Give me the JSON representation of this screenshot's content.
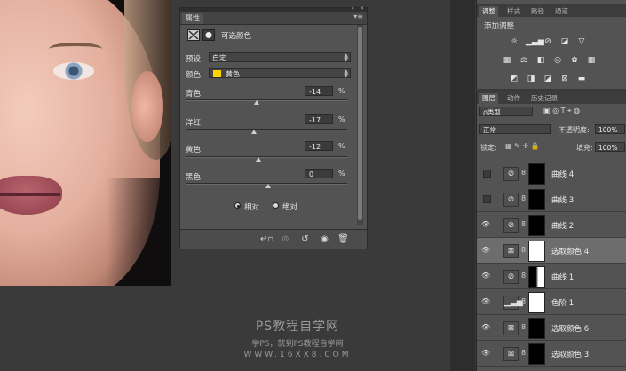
{
  "properties_panel": {
    "tab_title": "属性",
    "header_label": "可选颜色",
    "preset": {
      "label": "预设:",
      "value": "自定"
    },
    "colors": {
      "label": "颜色:",
      "value": "黄色",
      "swatch": "#ffd400"
    },
    "sliders": [
      {
        "label": "青色:",
        "value": "-14",
        "unit": "%",
        "position": 0.43
      },
      {
        "label": "洋红:",
        "value": "-17",
        "unit": "%",
        "position": 0.415
      },
      {
        "label": "黄色:",
        "value": "-12",
        "unit": "%",
        "position": 0.44
      },
      {
        "label": "黑色:",
        "value": "0",
        "unit": "%",
        "position": 0.5
      }
    ],
    "method": {
      "relative": "相对",
      "absolute": "绝对",
      "selected": "relative"
    }
  },
  "adjustments_panel": {
    "tabs": [
      "调整",
      "样式",
      "路径",
      "通道"
    ],
    "title": "添加调整"
  },
  "layers_panel": {
    "tabs": [
      "图层",
      "动作",
      "历史记录"
    ],
    "filter_label": "ρ类型",
    "blend_mode": "正常",
    "opacity_label": "不透明度:",
    "opacity_value": "100%",
    "lock_label": "锁定:",
    "fill_label": "填充:",
    "fill_value": "100%",
    "layers": [
      {
        "name": "曲线 4",
        "visible": false,
        "type": "curves",
        "mask": "black"
      },
      {
        "name": "曲线 3",
        "visible": false,
        "type": "curves",
        "mask": "black"
      },
      {
        "name": "曲线 2",
        "visible": true,
        "type": "curves",
        "mask": "black"
      },
      {
        "name": "选取颜色 4",
        "visible": true,
        "type": "selective",
        "mask": "white",
        "selected": true
      },
      {
        "name": "曲线 1",
        "visible": true,
        "type": "curves",
        "mask": "mixed"
      },
      {
        "name": "色阶 1",
        "visible": true,
        "type": "levels",
        "mask": "white"
      },
      {
        "name": "选取颜色 6",
        "visible": true,
        "type": "selective",
        "mask": "black"
      },
      {
        "name": "选取颜色 3",
        "visible": true,
        "type": "selective",
        "mask": "black"
      }
    ]
  },
  "watermark": {
    "line1": "PS教程自学网",
    "line2": "学PS，就到PS教程自学网",
    "line3": "WWW.16XX8.COM"
  }
}
